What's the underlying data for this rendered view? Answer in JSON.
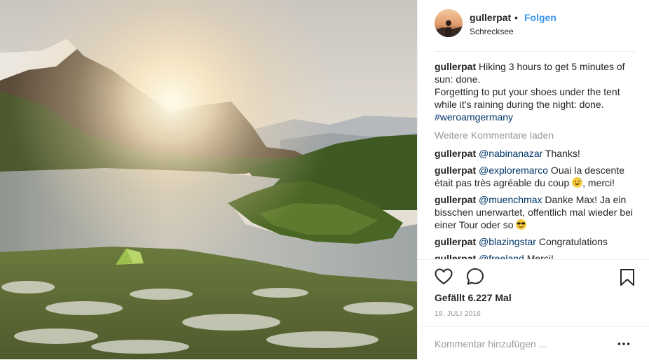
{
  "post": {
    "photo_icon": "landscape-photo",
    "author": {
      "username": "gullerpat",
      "separator": "•",
      "follow_label": "Folgen",
      "location": "Schrecksee"
    },
    "caption": {
      "username": "gullerpat",
      "line1": "Hiking 3 hours to get 5 minutes of sun: done.",
      "line2": "Forgetting to put your shoes under the tent while it's raining during the night: done.",
      "hashtag": "#weroamgermany"
    },
    "load_more_label": "Weitere Kommentare laden",
    "comments": [
      {
        "username": "gullerpat",
        "mention": "@nabinanazar",
        "text": " Thanks!",
        "text_after": ""
      },
      {
        "username": "gullerpat",
        "mention": "@exploremarco",
        "text": " Ouai la descente était pas très agréable du coup ",
        "emoji": "grinning-sweat-emoji",
        "text_after": ", merci!"
      },
      {
        "username": "gullerpat",
        "mention": "@muenchmax",
        "text": " Danke Max! Ja ein bisschen unerwartet, offentlich mal wieder bei einer Tour oder so ",
        "emoji": "sunglasses-emoji",
        "text_after": ""
      },
      {
        "username": "gullerpat",
        "mention": "@blazingstar",
        "text": " Congratulations",
        "text_after": ""
      },
      {
        "username": "gullerpat",
        "mention": "@freeland",
        "text": " Merci!",
        "text_after": ""
      }
    ],
    "actions": {
      "like_icon": "heart-icon",
      "comment_icon": "comment-bubble-icon",
      "save_icon": "bookmark-icon"
    },
    "likes_text": "Gefällt 6.227 Mal",
    "date_text": "18. JULI 2016",
    "add_comment": {
      "placeholder": "Kommentar hinzufügen ...",
      "options_icon": "more-horizontal-icon"
    }
  }
}
